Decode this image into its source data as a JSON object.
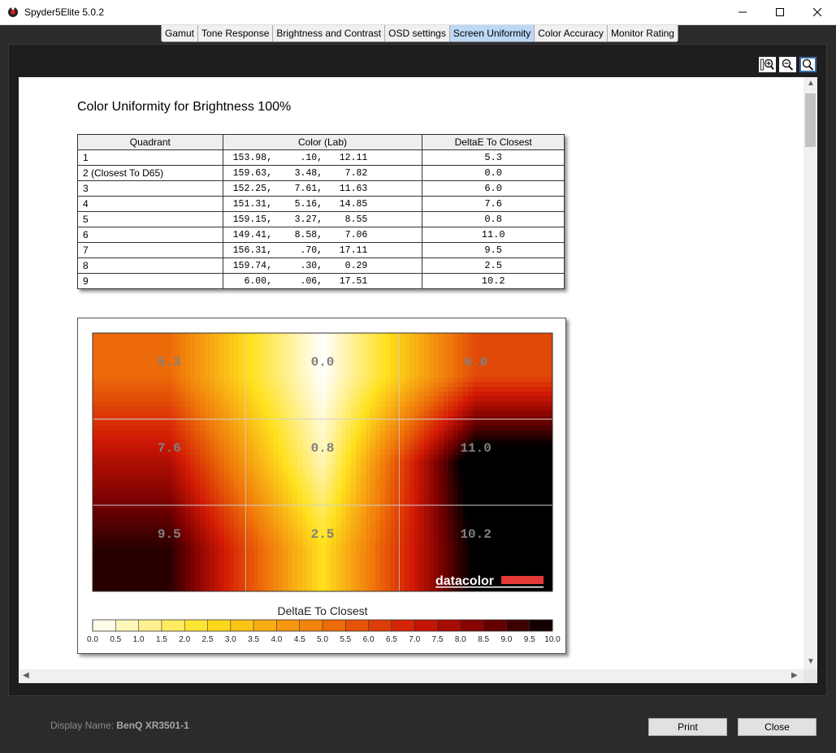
{
  "window": {
    "title": "Spyder5Elite 5.0.2"
  },
  "tabs": [
    {
      "label": "Gamut",
      "active": false
    },
    {
      "label": "Tone Response",
      "active": false
    },
    {
      "label": "Brightness and Contrast",
      "active": false
    },
    {
      "label": "OSD settings",
      "active": false
    },
    {
      "label": "Screen Uniformity",
      "active": true
    },
    {
      "label": "Color Accuracy",
      "active": false
    },
    {
      "label": "Monitor Rating",
      "active": false
    }
  ],
  "report": {
    "title": "Color Uniformity for Brightness 100%",
    "table": {
      "headers": [
        "Quadrant",
        "Color (Lab)",
        "DeltaE To Closest"
      ],
      "rows": [
        {
          "quadrant": "1",
          "lab": "153.98,     .10,   12.11",
          "delta": "5.3"
        },
        {
          "quadrant": "2 (Closest To D65)",
          "lab": "159.63,    3.48,    7.82",
          "delta": "0.0"
        },
        {
          "quadrant": "3",
          "lab": "152.25,    7.61,   11.63",
          "delta": "6.0"
        },
        {
          "quadrant": "4",
          "lab": "151.31,    5.16,   14.85",
          "delta": "7.6"
        },
        {
          "quadrant": "5",
          "lab": "159.15,    3.27,    8.55",
          "delta": "0.8"
        },
        {
          "quadrant": "6",
          "lab": "149.41,    8.58,    7.06",
          "delta": "11.0"
        },
        {
          "quadrant": "7",
          "lab": "156.31,     .70,   17.11",
          "delta": "9.5"
        },
        {
          "quadrant": "8",
          "lab": "159.74,     .30,    0.29",
          "delta": "2.5"
        },
        {
          "quadrant": "9",
          "lab": "  6.00,     .06,   17.51",
          "delta": "10.2"
        }
      ]
    }
  },
  "chart_data": {
    "type": "heatmap",
    "grid": "3x3",
    "cells": [
      [
        5.3,
        0.0,
        6.0
      ],
      [
        7.6,
        0.8,
        11.0
      ],
      [
        9.5,
        2.5,
        10.2
      ]
    ],
    "cell_labels": [
      "5.3",
      "0.0",
      "6.0",
      "7.6",
      "0.8",
      "11.0",
      "9.5",
      "2.5",
      "10.2"
    ],
    "legend_title": "DeltaE To Closest",
    "legend_ticks": [
      "0.0",
      "0.5",
      "1.0",
      "1.5",
      "2.0",
      "2.5",
      "3.0",
      "3.5",
      "4.0",
      "4.5",
      "5.0",
      "5.5",
      "6.0",
      "6.5",
      "7.0",
      "7.5",
      "8.0",
      "8.5",
      "9.0",
      "9.5",
      "10.0"
    ],
    "range": [
      0,
      10
    ],
    "logo": "datacolor",
    "colors": {
      "low": "#ffffff",
      "mid": "#ffd400",
      "high": "#d01000",
      "max": "#000000"
    }
  },
  "footer": {
    "display_label": "Display Name:",
    "display_name": "BenQ XR3501-1",
    "print_label": "Print",
    "close_label": "Close"
  }
}
